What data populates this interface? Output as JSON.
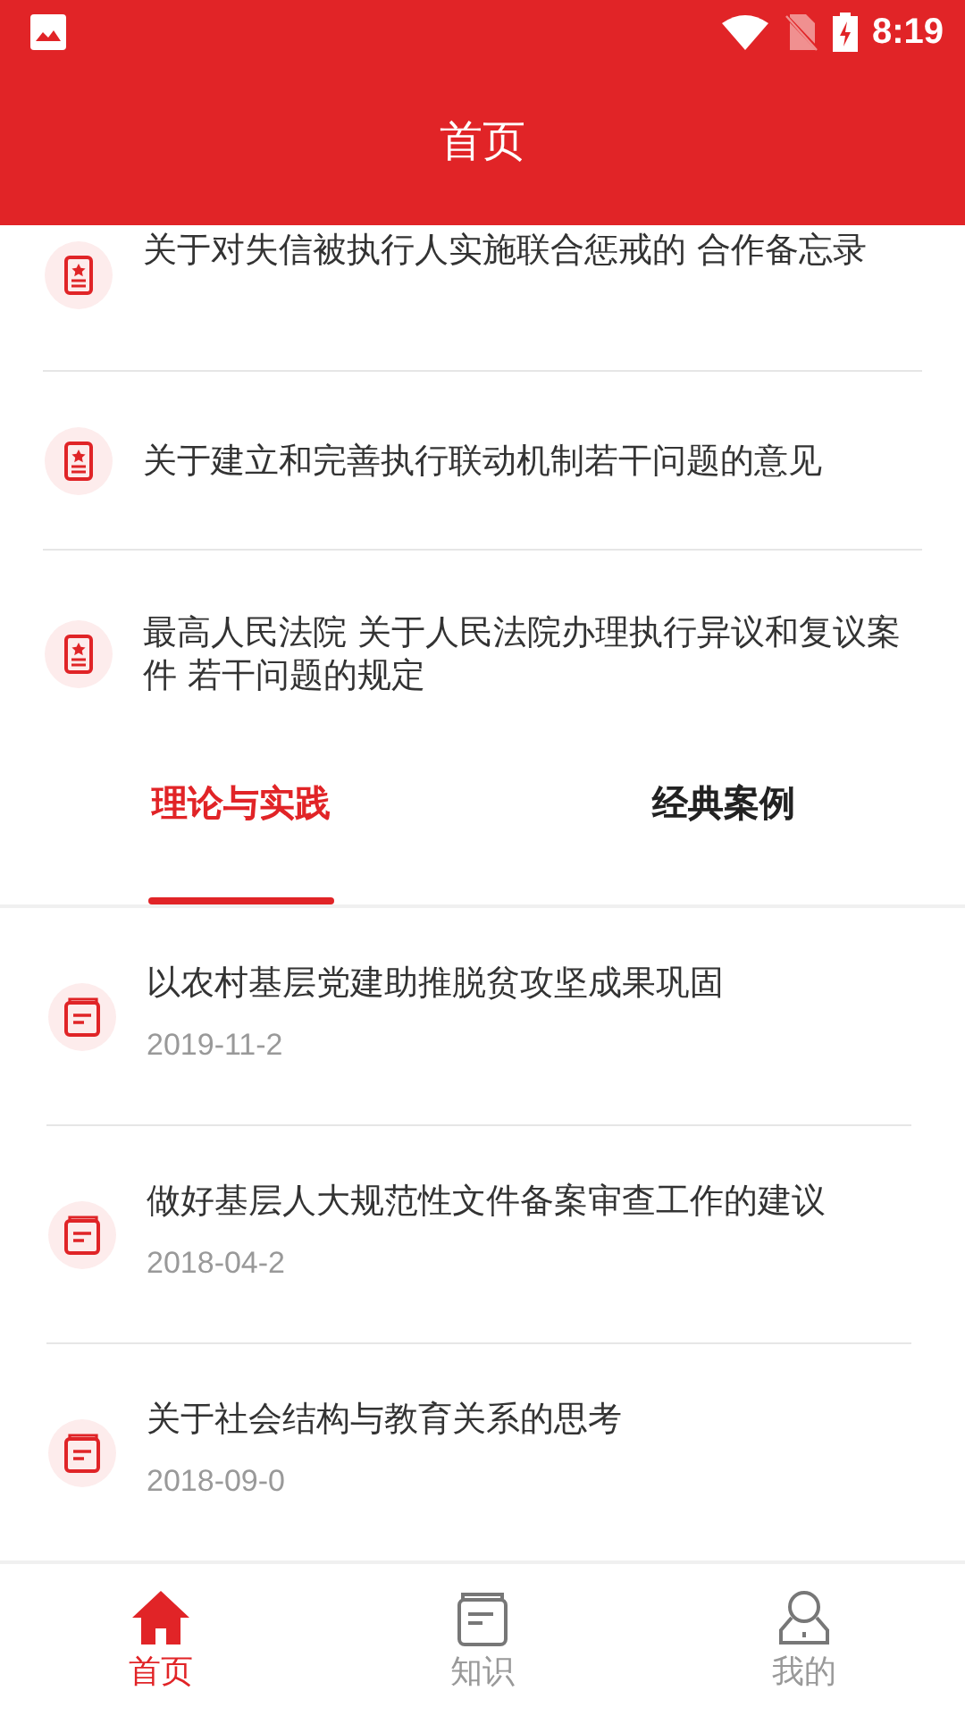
{
  "status_bar": {
    "time": "8:19"
  },
  "header": {
    "title": "首页"
  },
  "documents": [
    {
      "title": "关于对失信被执行人实施联合惩戒的 合作备忘录"
    },
    {
      "title": "关于建立和完善执行联动机制若干问题的意见"
    },
    {
      "title": "最高人民法院 关于人民法院办理执行异议和复议案件 若干问题的规定"
    }
  ],
  "tabs": [
    {
      "label": "理论与实践",
      "selected": true
    },
    {
      "label": "经典案例",
      "selected": false
    }
  ],
  "articles": [
    {
      "title": "以农村基层党建助推脱贫攻坚成果巩固",
      "date": "2019-11-2"
    },
    {
      "title": "做好基层人大规范性文件备案审查工作的建议",
      "date": "2018-04-2"
    },
    {
      "title": "关于社会结构与教育关系的思考",
      "date": "2018-09-0"
    }
  ],
  "bottom_nav": [
    {
      "label": "首页",
      "kind": "home",
      "selected": true
    },
    {
      "label": "知识",
      "kind": "book",
      "selected": false
    },
    {
      "label": "我的",
      "kind": "user",
      "selected": false
    }
  ]
}
